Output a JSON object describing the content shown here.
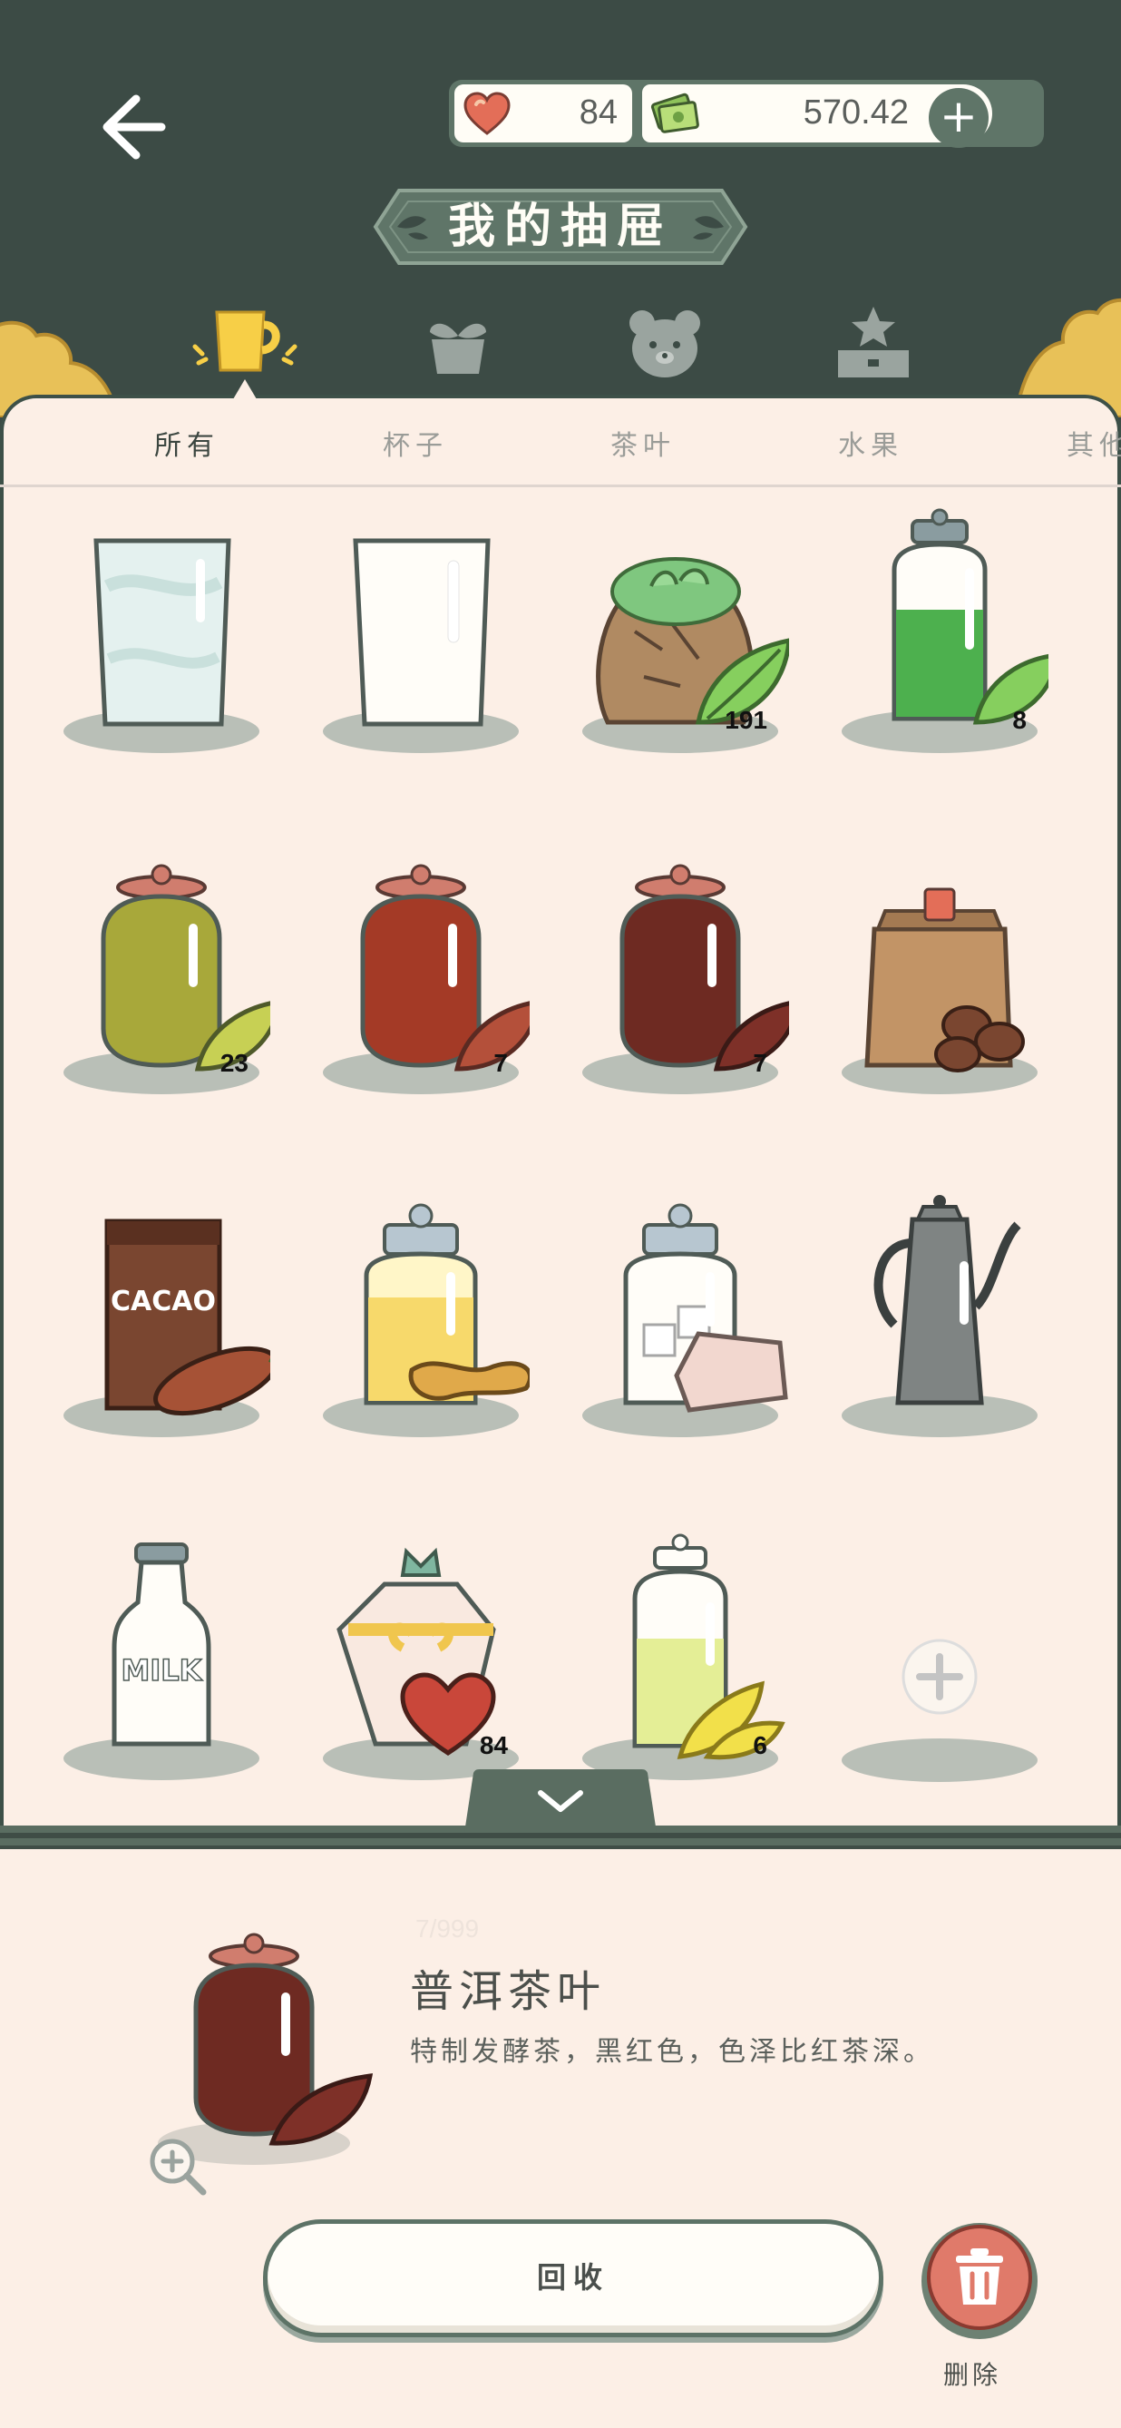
{
  "header": {
    "title": "我的抽屉",
    "hearts": "84",
    "money": "570.42",
    "plus_label": "+"
  },
  "category_tabs": [
    {
      "name": "cup",
      "icon": "cup-icon",
      "active": true
    },
    {
      "name": "plant",
      "icon": "plant-pot-icon",
      "active": false
    },
    {
      "name": "bear",
      "icon": "bear-icon",
      "active": false
    },
    {
      "name": "star",
      "icon": "star-stand-icon",
      "active": false
    }
  ],
  "subtabs": [
    "所有",
    "杯子",
    "茶叶",
    "水果",
    "其他"
  ],
  "items": [
    {
      "id": "glass-milk",
      "count": ""
    },
    {
      "id": "glass-empty",
      "count": ""
    },
    {
      "id": "green-tea-sack",
      "count": "191"
    },
    {
      "id": "green-tea-jar",
      "count": "8"
    },
    {
      "id": "yellow-tea-jar",
      "count": "23"
    },
    {
      "id": "red-tea-jar",
      "count": "7"
    },
    {
      "id": "puer-tea-jar",
      "count": "7"
    },
    {
      "id": "coffee-bean-bag",
      "count": ""
    },
    {
      "id": "cacao-box",
      "count": ""
    },
    {
      "id": "ginger-jar",
      "count": ""
    },
    {
      "id": "sugar-jar",
      "count": ""
    },
    {
      "id": "coffee-pot",
      "count": ""
    },
    {
      "id": "milk-bottle",
      "count": ""
    },
    {
      "id": "heart-candy-jar",
      "count": "84"
    },
    {
      "id": "sparkle-tea-jar",
      "count": "6"
    },
    {
      "id": "add-slot",
      "count": ""
    }
  ],
  "cacao_label": "CACAO",
  "milk_label": "MILK",
  "detail": {
    "count": "7/999",
    "name": "普洱茶叶",
    "description": "特制发酵茶，黑红色，色泽比红茶深。",
    "recycle_label": "回收",
    "delete_label": "删除"
  },
  "colors": {
    "header": "#3c4b45",
    "panel": "#fcefe6",
    "accent_green": "#5f7568",
    "delete_red": "#e07a6a"
  }
}
